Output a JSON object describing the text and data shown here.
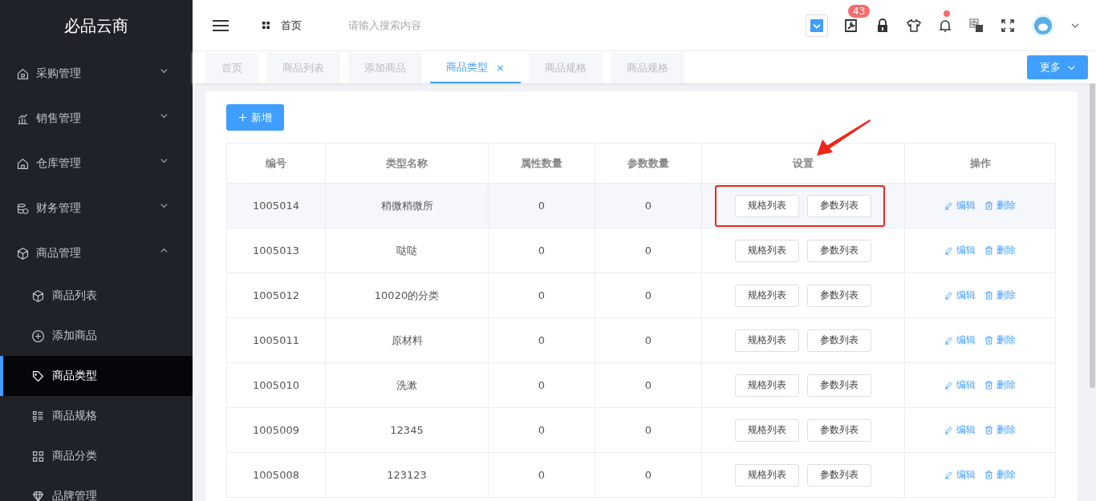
{
  "sidebar": {
    "logo": "必品云商",
    "items": [
      {
        "label": "采购管理",
        "expanded": false
      },
      {
        "label": "销售管理",
        "expanded": false
      },
      {
        "label": "仓库管理",
        "expanded": false
      },
      {
        "label": "财务管理",
        "expanded": false
      },
      {
        "label": "商品管理",
        "expanded": true,
        "children": [
          {
            "label": "商品列表",
            "selected": false
          },
          {
            "label": "添加商品",
            "selected": false
          },
          {
            "label": "商品类型",
            "selected": true
          },
          {
            "label": "商品规格",
            "selected": false
          },
          {
            "label": "商品分类",
            "selected": false
          },
          {
            "label": "品牌管理",
            "selected": false
          }
        ]
      }
    ]
  },
  "header": {
    "breadcrumb": "首页",
    "search": {
      "placeholder": "请输入搜索内容"
    },
    "badge": "43",
    "bell_dot": true
  },
  "tabs": [
    {
      "label": "首页",
      "selected": false
    },
    {
      "label": "商品列表",
      "selected": false
    },
    {
      "label": "添加商品",
      "selected": false
    },
    {
      "label": "商品类型",
      "selected": true,
      "close": "×"
    },
    {
      "label": "商品规格",
      "selected": false
    },
    {
      "label": "商品规格",
      "selected": false
    }
  ],
  "more_button": "更多",
  "add_button": "新增",
  "table": {
    "columns": [
      "编号",
      "类型名称",
      "属性数量",
      "参数数量",
      "设置",
      "操作"
    ],
    "rows": [
      {
        "id": "1005014",
        "name": "稍微稍微所",
        "attrs": "0",
        "params": "0",
        "spec": "规格列表",
        "param_list": "参数列表",
        "edit": "编辑",
        "delete": "删除",
        "highlighted": true
      },
      {
        "id": "1005013",
        "name": "哒哒",
        "attrs": "0",
        "params": "0",
        "spec": "规格列表",
        "param_list": "参数列表",
        "edit": "编辑",
        "delete": "删除",
        "highlighted": false
      },
      {
        "id": "1005012",
        "name": "10020的分类",
        "attrs": "0",
        "params": "0",
        "spec": "规格列表",
        "param_list": "参数列表",
        "edit": "编辑",
        "delete": "删除",
        "highlighted": false
      },
      {
        "id": "1005011",
        "name": "原材料",
        "attrs": "0",
        "params": "0",
        "spec": "规格列表",
        "param_list": "参数列表",
        "edit": "编辑",
        "delete": "删除",
        "highlighted": false
      },
      {
        "id": "1005010",
        "name": "洗漱",
        "attrs": "0",
        "params": "0",
        "spec": "规格列表",
        "param_list": "参数列表",
        "edit": "编辑",
        "delete": "删除",
        "highlighted": false
      },
      {
        "id": "1005009",
        "name": "12345",
        "attrs": "0",
        "params": "0",
        "spec": "规格列表",
        "param_list": "参数列表",
        "edit": "编辑",
        "delete": "删除",
        "highlighted": false
      },
      {
        "id": "1005008",
        "name": "123123",
        "attrs": "0",
        "params": "0",
        "spec": "规格列表",
        "param_list": "参数列表",
        "edit": "编辑",
        "delete": "删除",
        "highlighted": false
      }
    ]
  }
}
